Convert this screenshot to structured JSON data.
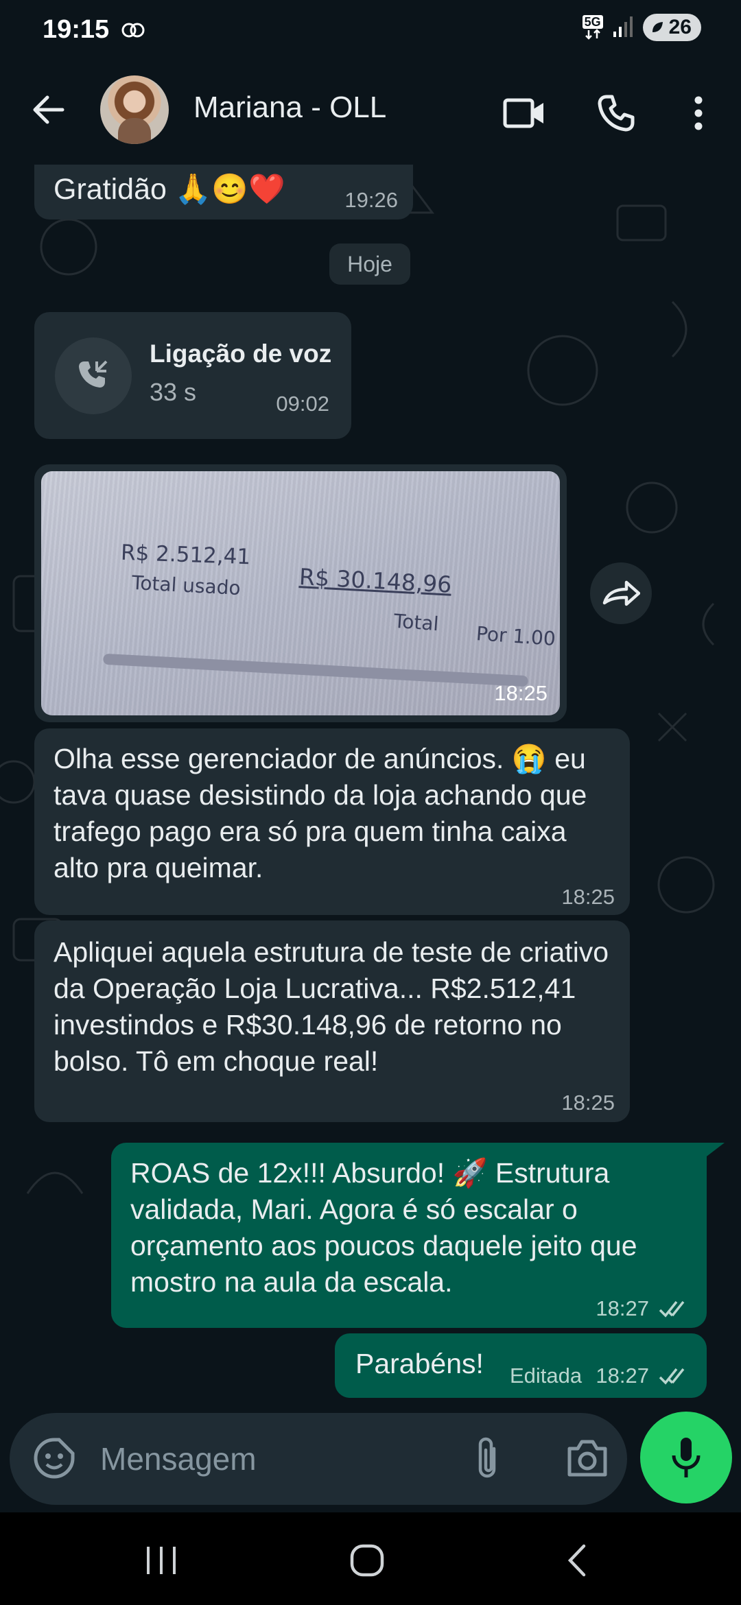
{
  "status_bar": {
    "time": "19:15",
    "network": "5G",
    "battery": "26"
  },
  "header": {
    "contact_name": "Mariana - OLL"
  },
  "chat": {
    "messages": [
      {
        "type": "incoming_text",
        "text": "Gratidão 🙏😊❤️",
        "time": "19:26"
      },
      {
        "type": "date_chip",
        "text": "Hoje"
      },
      {
        "type": "incoming_call",
        "title": "Ligação de voz",
        "duration": "33 s",
        "time": "09:02"
      },
      {
        "type": "incoming_image",
        "image_text": {
          "used_value": "R$ 2.512,41",
          "used_label": "Total usado",
          "total_value": "R$ 30.148,96",
          "total_label": "Total",
          "per_label": "Por 1.00"
        },
        "time": "18:25"
      },
      {
        "type": "incoming_text",
        "text": "Olha esse gerenciador de anúncios. 😭 eu tava quase desistindo da loja achando que trafego pago era só pra quem tinha caixa alto pra queimar.",
        "time": "18:25"
      },
      {
        "type": "incoming_text",
        "text": "Apliquei aquela estrutura de teste de criativo da Operação Loja Lucrativa... R$2.512,41 investindos e R$30.148,96 de retorno no bolso. Tô em choque real!",
        "time": "18:25"
      },
      {
        "type": "outgoing_text",
        "text": "ROAS de 12x!!! Absurdo! 🚀 Estrutura validada, Mari. Agora é só escalar o orçamento aos poucos daquele jeito que mostro na aula da escala.",
        "time": "18:27",
        "status": "read"
      },
      {
        "type": "outgoing_text",
        "text": "Parabéns!",
        "edited_label": "Editada",
        "time": "18:27",
        "status": "read"
      }
    ]
  },
  "composer": {
    "placeholder": "Mensagem"
  },
  "colors": {
    "background": "#0b141a",
    "incoming": "#202c33",
    "outgoing": "#005c4b",
    "accent": "#25d366",
    "read_ticks": "#53bdeb"
  },
  "icons": [
    "back-arrow-icon",
    "video-call-icon",
    "phone-icon",
    "more-vert-icon",
    "incoming-call-icon",
    "forward-icon",
    "sticker-icon",
    "attach-icon",
    "camera-icon",
    "mic-icon",
    "double-check-icon"
  ]
}
